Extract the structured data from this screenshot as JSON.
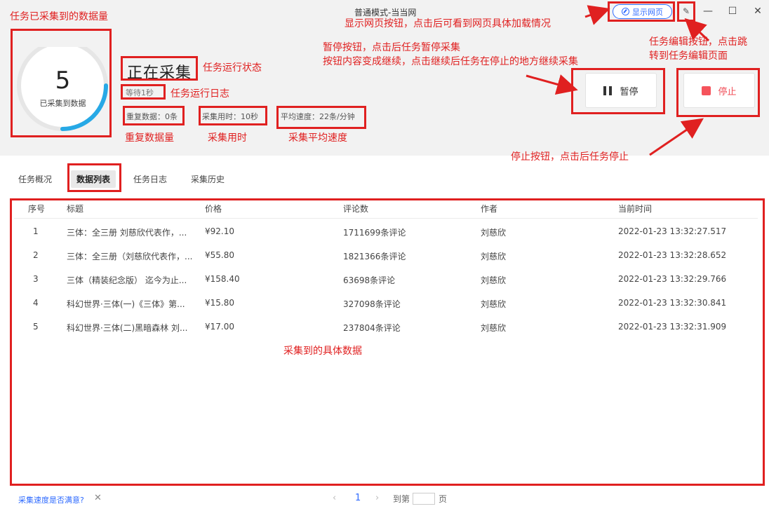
{
  "window": {
    "title": "普通模式-当当网",
    "view_page_label": "显示网页",
    "edit_icon": "edit-icon"
  },
  "summary": {
    "count": "5",
    "count_label": "已采集到数据",
    "status": "正在采集",
    "log": "等待1秒",
    "duplicates": "重复数据：0条",
    "elapsed": "采集用时：10秒",
    "speed": "平均速度：22条/分钟",
    "ring_progress": 0.25
  },
  "controls": {
    "pause_label": "暂停",
    "stop_label": "停止"
  },
  "tabs": [
    "任务概况",
    "数据列表",
    "任务日志",
    "采集历史"
  ],
  "table": {
    "columns": [
      "序号",
      "标题",
      "价格",
      "评论数",
      "作者",
      "当前时间"
    ],
    "rows": [
      [
        "1",
        "三体：全三册 刘慈欣代表作，...",
        "¥92.10",
        "1711699条评论",
        "刘慈欣",
        "2022-01-23 13:32:27.517"
      ],
      [
        "2",
        "三体：全三册（刘慈欣代表作，...",
        "¥55.80",
        "1821366条评论",
        "刘慈欣",
        "2022-01-23 13:32:28.652"
      ],
      [
        "3",
        "三体（精装纪念版） 迄今为止...",
        "¥158.40",
        "63698条评论",
        "刘慈欣",
        "2022-01-23 13:32:29.766"
      ],
      [
        "4",
        "科幻世界·三体(一)《三体》第...",
        "¥15.80",
        "327098条评论",
        "刘慈欣",
        "2022-01-23 13:32:30.841"
      ],
      [
        "5",
        "科幻世界·三体(二)黑暗森林 刘...",
        "¥17.00",
        "237804条评论",
        "刘慈欣",
        "2022-01-23 13:32:31.909"
      ]
    ]
  },
  "footer": {
    "feedback": "采集速度是否满意?",
    "page_current": "1",
    "goto_label": "到第",
    "page_unit": "页"
  },
  "annotations": {
    "count": "任务已采集到的数据量",
    "status": "任务运行状态",
    "log": "任务运行日志",
    "duplicates": "重复数据量",
    "elapsed": "采集用时",
    "speed": "采集平均速度",
    "view_page": "显示网页按钮，点击后可看到网页具体加载情况",
    "edit_line1": "任务编辑按钮，点击跳",
    "edit_line2": "转到任务编辑页面",
    "pause_line1": "暂停按钮，点击后任务暂停采集",
    "pause_line2": "按钮内容变成继续，点击继续后任务在停止的地方继续采集",
    "stop": "停止按钮，点击后任务停止",
    "data": "采集到的具体数据"
  },
  "colors": {
    "accent": "#2f6bff",
    "annotation": "#e02020",
    "stop": "#f5535c"
  }
}
